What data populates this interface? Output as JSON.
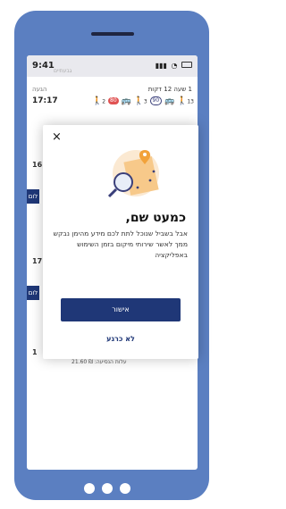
{
  "status_bar": {
    "time": "9:41",
    "map_label": "גבעתיים"
  },
  "trip": {
    "arrival_label": "הגעה",
    "arrival_time": "17:17",
    "duration": "1 שעה 12 דקות",
    "route": {
      "bus_a": "80",
      "bus_b": "90",
      "walk_a": "2",
      "walk_b": "3",
      "walk_c": "13"
    }
  },
  "background_rows": [
    {
      "time": "16",
      "tab": "לום"
    },
    {
      "time": "17",
      "tab": "לום"
    },
    {
      "time": "1"
    }
  ],
  "fare": "עלות הנסיעה: ₪ 21.60",
  "modal": {
    "title": "כמעט שם,",
    "body": "אבל בשביל שנוכל לתת לכם מידע מהימן נבקש ממך לאשר שירותי מיקום בזמן השימוש באפליקציה",
    "confirm_label": "אישור",
    "not_now_label": "לא כרגע",
    "close_glyph": "×"
  },
  "colors": {
    "phone": "#5b7fc1",
    "primary": "#1f3777",
    "accent_orange": "#f2a23a",
    "badge_red": "#e05252"
  }
}
